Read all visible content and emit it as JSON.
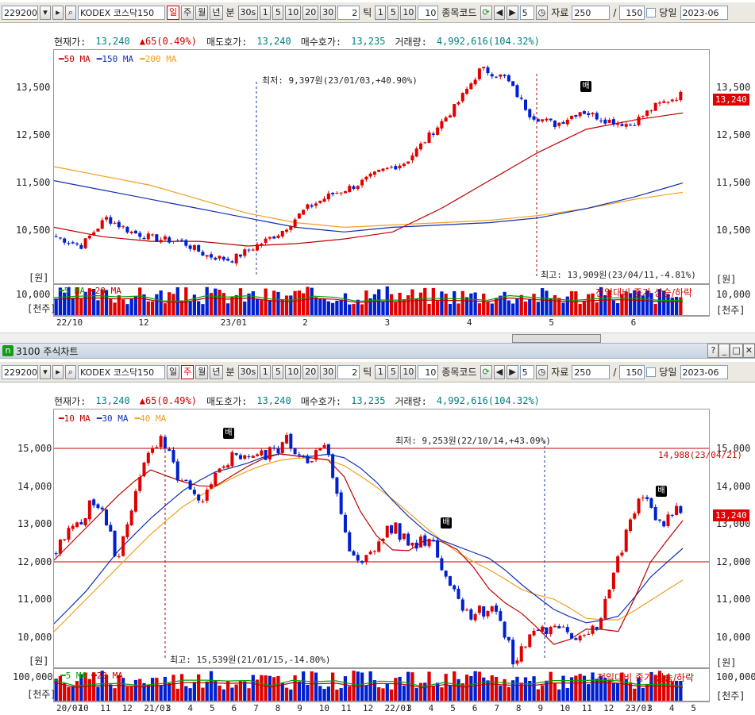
{
  "top": {
    "toolbar": {
      "code": "229200",
      "name": "KODEX 코스닥150",
      "period_buttons": [
        "일",
        "주",
        "월",
        "년"
      ],
      "active_period": "일",
      "minute_label": "분",
      "interval_buttons": [
        "30s",
        "1",
        "5",
        "10",
        "20",
        "30"
      ],
      "tick_value": "2",
      "tick_label": "틱",
      "tick_buttons": [
        "1",
        "5",
        "10"
      ],
      "tick_extra": "10",
      "stock_code_label": "종목코드",
      "step_value": "5",
      "data_label": "자료",
      "data_count": "250",
      "view_count": "150",
      "same_day_label": "당일",
      "date": "2023-06"
    },
    "info": {
      "current_label": "현재가:",
      "current_value": "13,240",
      "change": "▲65(0.49%)",
      "ask_label": "매도호가:",
      "ask_value": "13,240",
      "bid_label": "매수호가:",
      "bid_value": "13,235",
      "volume_label": "거래량:",
      "volume_value": "4,992,616(104.32%)"
    },
    "legend": [
      "50 MA",
      "150 MA",
      "200 MA"
    ],
    "y_labels": [
      "13,500",
      "12,500",
      "11,500",
      "10,500"
    ],
    "unit_won": "[원]",
    "price_tag": "13,240",
    "low_annotation": "최저: 9,397원(23/01/03,+40.90%)",
    "high_annotation": "최고: 13,909원(23/04/11,-4.81%)",
    "badge": "배",
    "volume": {
      "legend": [
        "5 MA",
        "20 MA"
      ],
      "note": "전일대비 종가 상승/하락",
      "y_label": "10,000",
      "unit": "[천주]"
    },
    "dates": [
      "22/10",
      "12",
      "23/01",
      "2",
      "3",
      "4",
      "5",
      "6"
    ]
  },
  "window": {
    "title": "3100 주식차트",
    "icon": "n"
  },
  "bottom": {
    "toolbar": {
      "code": "229200",
      "name": "KODEX 코스닥150",
      "period_buttons": [
        "일",
        "주",
        "월",
        "년"
      ],
      "active_period": "주",
      "minute_label": "분",
      "interval_buttons": [
        "30s",
        "1",
        "5",
        "10",
        "20",
        "30"
      ],
      "tick_value": "2",
      "tick_label": "틱",
      "tick_buttons": [
        "1",
        "5",
        "10"
      ],
      "tick_extra": "10",
      "stock_code_label": "종목코드",
      "step_value": "5",
      "data_label": "자료",
      "data_count": "250",
      "view_count": "150",
      "same_day_label": "당일",
      "date": "2023-06"
    },
    "info": {
      "current_label": "현재가:",
      "current_value": "13,240",
      "change": "▲65(0.49%)",
      "ask_label": "매도호가:",
      "ask_value": "13,240",
      "bid_label": "매수호가:",
      "bid_value": "13,235",
      "volume_label": "거래량:",
      "volume_value": "4,992,616(104.32%)"
    },
    "legend": [
      "10 MA",
      "30 MA",
      "40 MA"
    ],
    "y_labels": [
      "15,000",
      "14,000",
      "13,000",
      "12,000",
      "11,000",
      "10,000"
    ],
    "unit_won": "[원]",
    "price_tag": "13,240",
    "low_annotation": "최저: 9,253원(22/10/14,+43.09%)",
    "high_annotation": "최고: 15,539원(21/01/15,-14.80%)",
    "hline_label": "14,988(23/04/21)",
    "badge": "배",
    "volume": {
      "legend": [
        "5 MA",
        "20 MA"
      ],
      "note": "전일대비 종가 상승/하락",
      "y_label": "100,000",
      "unit": "[천주]"
    },
    "dates": [
      "20/07",
      "10",
      "11",
      "12",
      "21/01",
      "3",
      "4",
      "5",
      "6",
      "7",
      "8",
      "9",
      "10",
      "11",
      "12",
      "22/01",
      "3",
      "4",
      "5",
      "6",
      "7",
      "8",
      "9",
      "10",
      "11",
      "12",
      "23/01",
      "3",
      "4",
      "5"
    ]
  },
  "colors": {
    "up": "#e00000",
    "down": "#0020d0",
    "ma_short": "#c00000",
    "ma_mid": "#1030b0",
    "ma_long": "#f0a020",
    "vol_ma5": "#00a000",
    "vol_ma20": "#c00000"
  }
}
